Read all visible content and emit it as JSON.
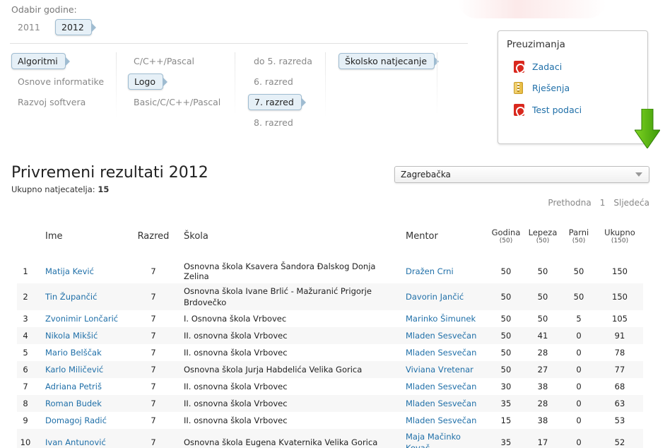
{
  "year_filter": {
    "label": "Odabir godine:",
    "years": [
      {
        "label": "2011",
        "selected": false
      },
      {
        "label": "2012",
        "selected": true
      }
    ]
  },
  "filters": {
    "col1": [
      {
        "label": "Algoritmi",
        "selected": true
      },
      {
        "label": "Osnove informatike",
        "selected": false
      },
      {
        "label": "Razvoj softvera",
        "selected": false
      }
    ],
    "col2": [
      {
        "label": "C/C++/Pascal",
        "selected": false
      },
      {
        "label": "Logo",
        "selected": true
      },
      {
        "label": "Basic/C/C++/Pascal",
        "selected": false
      }
    ],
    "col3": [
      {
        "label": "do 5. razreda",
        "selected": false
      },
      {
        "label": "6. razred",
        "selected": false
      },
      {
        "label": "7. razred",
        "selected": true
      },
      {
        "label": "8. razred",
        "selected": false
      }
    ],
    "col4": [
      {
        "label": "Školsko natjecanje",
        "selected": true
      }
    ]
  },
  "downloads": {
    "title": "Preuzimanja",
    "items": [
      {
        "label": "Zadaci",
        "icon": "pdf-icon"
      },
      {
        "label": "Rješenja",
        "icon": "zip-icon"
      },
      {
        "label": "Test podaci",
        "icon": "pdf-icon"
      }
    ]
  },
  "results": {
    "title": "Privremeni rezultati 2012",
    "total_label": "Ukupno natjecatelja:",
    "total_value": "15",
    "county_select": "Zagrebačka",
    "pager": {
      "prev": "Prethodna",
      "page": "1",
      "next": "Sljedeća"
    },
    "columns": {
      "name": "Ime",
      "grade": "Razred",
      "school": "Škola",
      "mentor": "Mentor",
      "t1": "Godina",
      "t1_max": "(50)",
      "t2": "Lepeza",
      "t2_max": "(50)",
      "t3": "Parni",
      "t3_max": "(50)",
      "total": "Ukupno",
      "total_max": "(150)"
    },
    "rows": [
      {
        "rank": "1",
        "name": "Matija Kević",
        "grade": "7",
        "school": "Osnovna škola Ksavera Šandora Đalskog Donja Zelina",
        "mentor": "Dražen Crni",
        "t1": "50",
        "t2": "50",
        "t3": "50",
        "total": "150"
      },
      {
        "rank": "2",
        "name": "Tin Župančić",
        "grade": "7",
        "school": "Osnovna škola Ivane Brlić - Mažuranić Prigorje Brdovečko",
        "mentor": "Davorin Jančić",
        "t1": "50",
        "t2": "50",
        "t3": "50",
        "total": "150"
      },
      {
        "rank": "3",
        "name": "Zvonimir Lončarić",
        "grade": "7",
        "school": "I. Osnovna škola Vrbovec",
        "mentor": "Marinko Šimunek",
        "t1": "50",
        "t2": "50",
        "t3": "5",
        "total": "105"
      },
      {
        "rank": "4",
        "name": "Nikola Mikšić",
        "grade": "7",
        "school": "II. osnovna škola Vrbovec",
        "mentor": "Mladen Sesvečan",
        "t1": "50",
        "t2": "41",
        "t3": "0",
        "total": "91"
      },
      {
        "rank": "5",
        "name": "Mario Belščak",
        "grade": "7",
        "school": "II. osnovna škola Vrbovec",
        "mentor": "Mladen Sesvečan",
        "t1": "50",
        "t2": "28",
        "t3": "0",
        "total": "78"
      },
      {
        "rank": "6",
        "name": "Karlo Miličević",
        "grade": "7",
        "school": "Osnovna škola Jurja Habdelića Velika Gorica",
        "mentor": "Viviana Vretenar",
        "t1": "50",
        "t2": "27",
        "t3": "0",
        "total": "77"
      },
      {
        "rank": "7",
        "name": "Adriana Petriš",
        "grade": "7",
        "school": "II. osnovna škola Vrbovec",
        "mentor": "Mladen Sesvečan",
        "t1": "30",
        "t2": "38",
        "t3": "0",
        "total": "68"
      },
      {
        "rank": "8",
        "name": "Roman Budek",
        "grade": "7",
        "school": "II. osnovna škola Vrbovec",
        "mentor": "Mladen Sesvečan",
        "t1": "35",
        "t2": "28",
        "t3": "0",
        "total": "63"
      },
      {
        "rank": "9",
        "name": "Domagoj Radić",
        "grade": "7",
        "school": "II. osnovna škola Vrbovec",
        "mentor": "Mladen Sesvečan",
        "t1": "15",
        "t2": "38",
        "t3": "0",
        "total": "53"
      },
      {
        "rank": "10",
        "name": "Ivan Antunović",
        "grade": "7",
        "school": "Osnovna škola Eugena Kvaternika Velika Gorica",
        "mentor": "Maja Mačinko Kovač",
        "t1": "35",
        "t2": "17",
        "t3": "0",
        "total": "52"
      }
    ]
  }
}
